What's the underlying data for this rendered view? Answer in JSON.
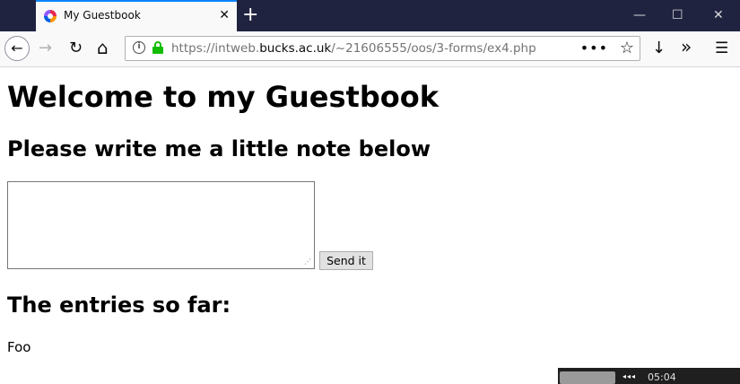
{
  "browser": {
    "tab_title": "My Guestbook",
    "tab_close": "✕",
    "newtab": "+",
    "window_controls": {
      "minimize": "—",
      "maximize": "☐",
      "close": "✕"
    },
    "nav": {
      "back": "←",
      "forward": "→",
      "reload": "↻",
      "home": "⌂",
      "download": "↓",
      "overflow": "»",
      "menu": "☰"
    },
    "url_prefix": "https://intweb.",
    "url_host": "bucks.ac.uk",
    "url_path": "/~21606555/oos/3-forms/ex4.php",
    "page_actions": "•••",
    "bookmark_star": "☆",
    "accent_color": "#0a84ff",
    "lock_color": "#12bc00"
  },
  "page": {
    "heading": "Welcome to my Guestbook",
    "subheading": "Please write me a little note below",
    "note_value": "",
    "send_label": "Send it",
    "entries_heading": "The entries so far:",
    "entries": [
      "Foo"
    ]
  },
  "taskbar": {
    "controls": "◂◂◂",
    "time": "05:04"
  }
}
